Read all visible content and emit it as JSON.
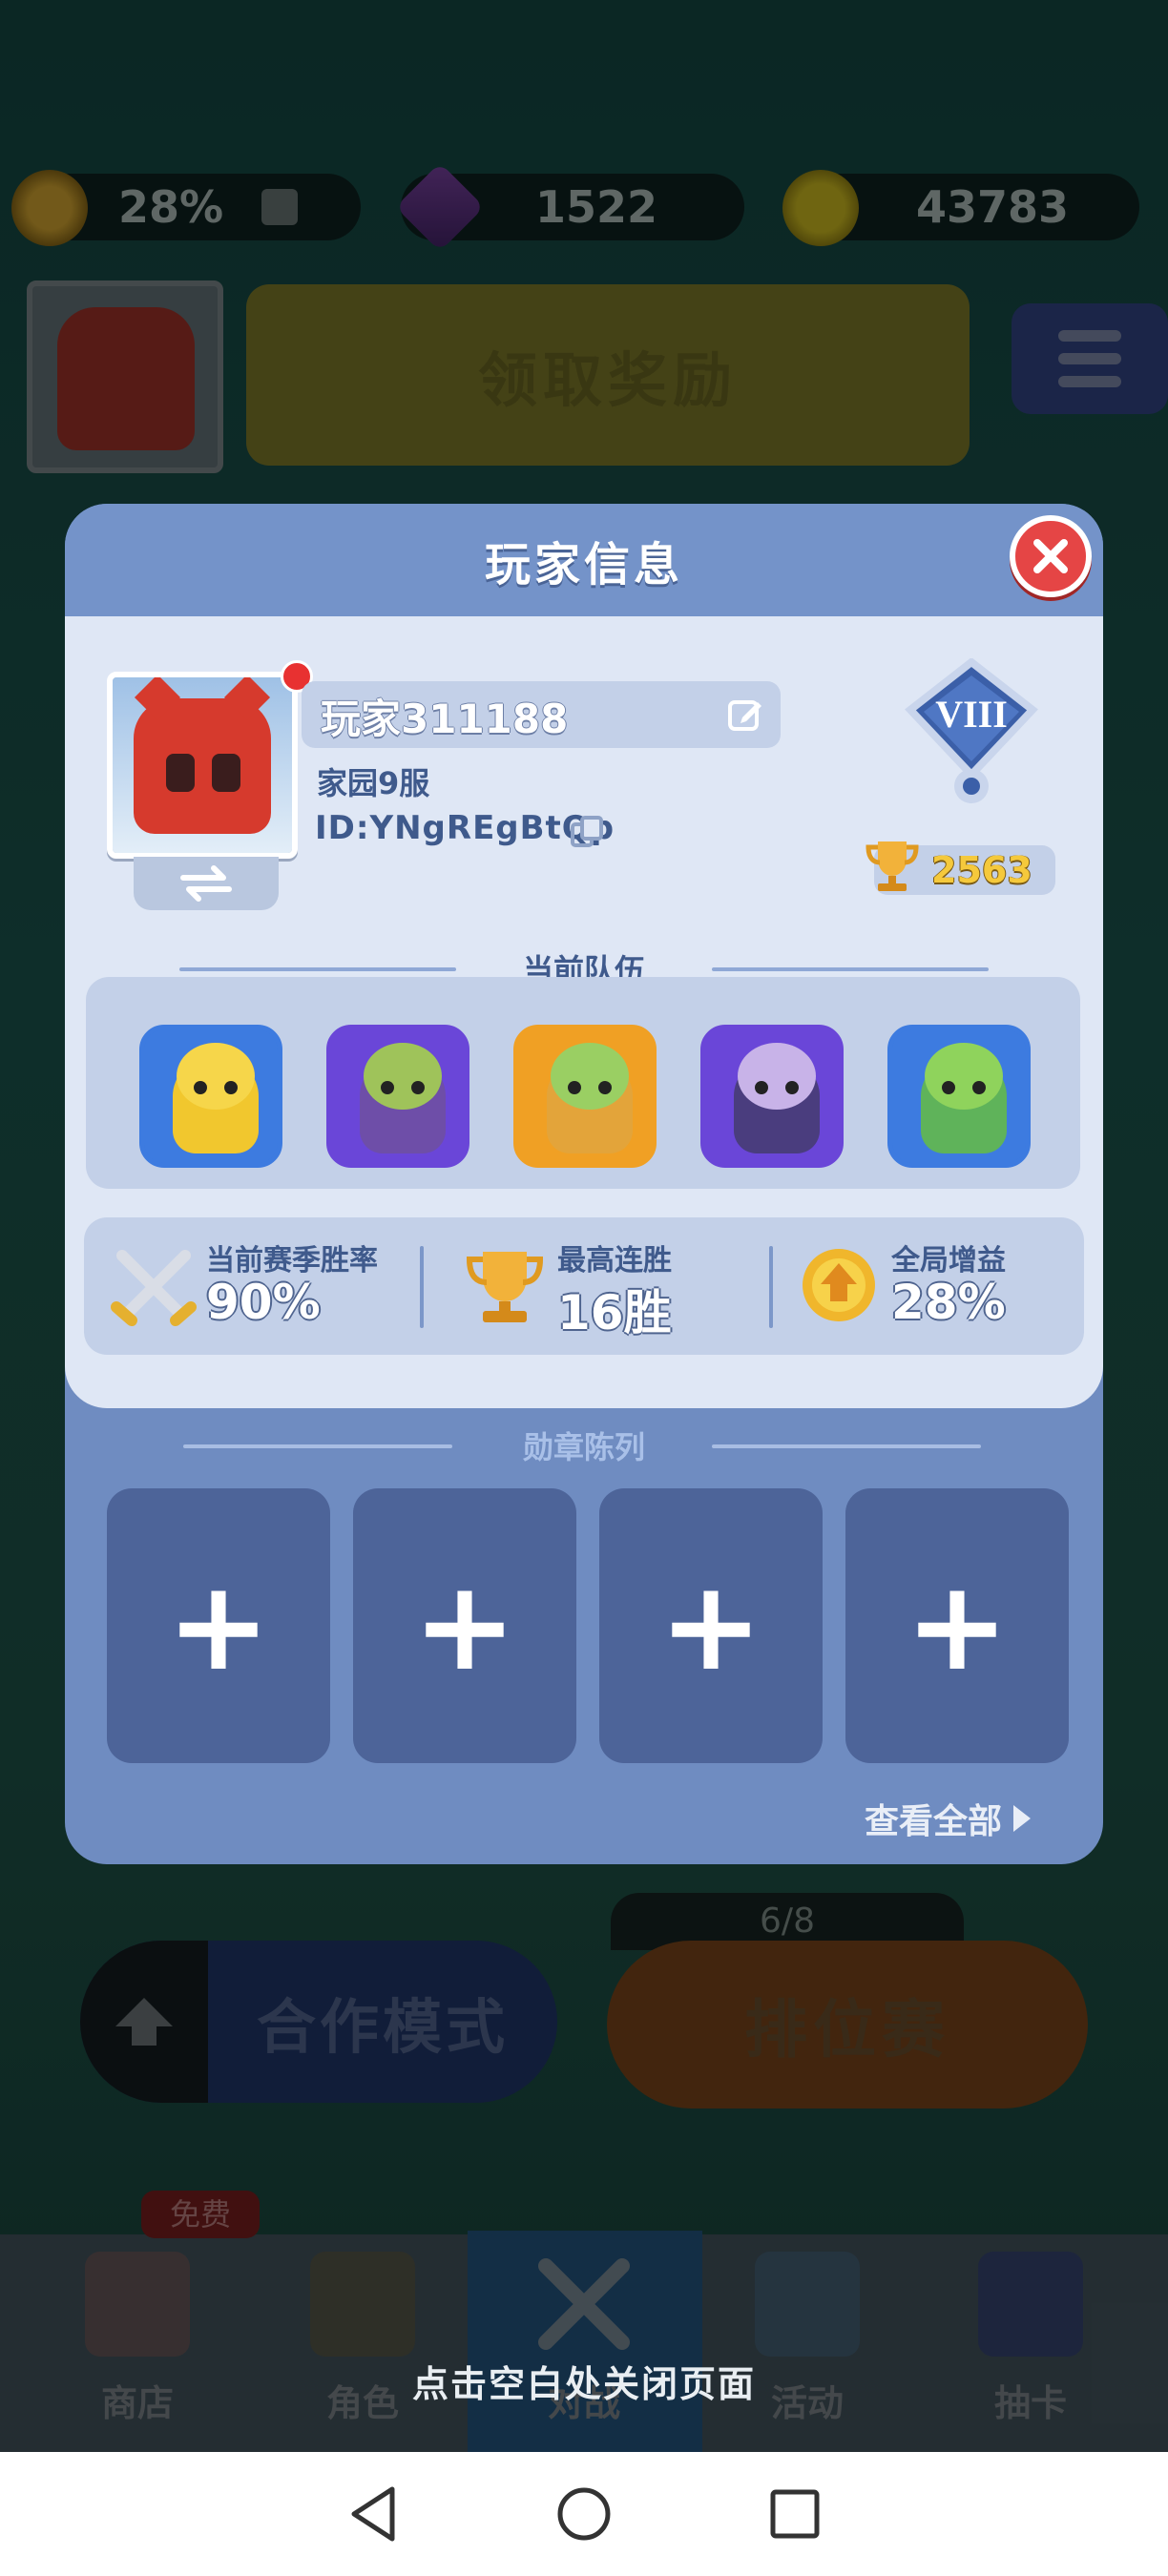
{
  "top_bar": {
    "boost_percent": "28%",
    "gems": "1522",
    "coins": "43783"
  },
  "background": {
    "claim_reward_label": "领取奖励",
    "coop_mode_label": "合作模式",
    "ranked_label": "排位赛",
    "ranked_progress": "6/8",
    "free_badge": "免费",
    "tabs": [
      "商店",
      "角色",
      "对战",
      "活动",
      "抽卡"
    ]
  },
  "dialog": {
    "title": "玩家信息",
    "player": {
      "name": "玩家311188",
      "server": "家园9服",
      "id": "ID:YNgREgBtQp",
      "rank_icon": "rank-viii-badge",
      "trophies": "2563"
    },
    "team_section_title": "当前队伍",
    "team": [
      {
        "name": "golden-warrior",
        "frame": "#3d7be0",
        "body": "#f1c72e",
        "head": "#f6d64a"
      },
      {
        "name": "goblin-engineer",
        "frame": "#6a46d8",
        "body": "#6e4ea8",
        "head": "#9fc35a"
      },
      {
        "name": "king-of-jungle",
        "frame": "#f0a024",
        "body": "#e3a43a",
        "head": "#9acf63"
      },
      {
        "name": "shadow-mage",
        "frame": "#6a46d8",
        "body": "#4a3d7e",
        "head": "#c8b3e8"
      },
      {
        "name": "leaf-brawler",
        "frame": "#3d7be0",
        "body": "#5fb35a",
        "head": "#8fd35c"
      }
    ],
    "stats": [
      {
        "label": "当前赛季胜率",
        "value": "90%",
        "icon": "crossed-swords-icon"
      },
      {
        "label": "最高连胜",
        "value": "16胜",
        "icon": "trophy-icon"
      },
      {
        "label": "全局增益",
        "value": "28%",
        "icon": "boost-crown-icon"
      }
    ],
    "medal_section_title": "勋章陈列",
    "medal_slots": [
      "+",
      "+",
      "+",
      "+"
    ],
    "view_all_label": "查看全部"
  },
  "close_hint": "点击空白处关闭页面",
  "colors": {
    "dialog_header": "#7493c9",
    "dialog_body": "#dfe7f5",
    "close_red": "#e54545",
    "text_blue": "#3f5a8c"
  }
}
